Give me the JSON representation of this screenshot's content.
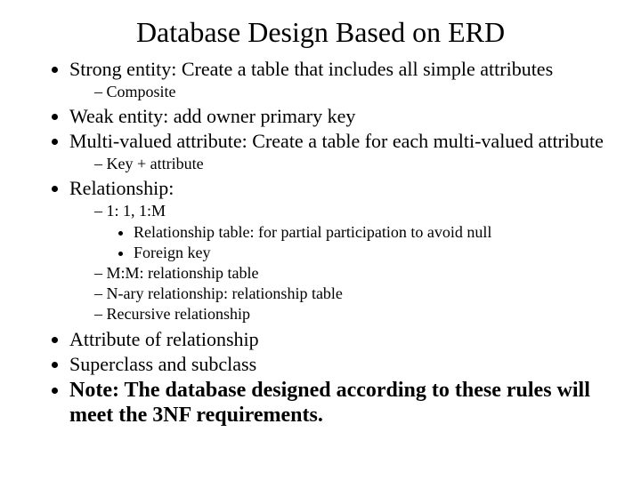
{
  "title": "Database Design Based on ERD",
  "bullets": {
    "strongEntity": "Strong entity: Create a table that includes all simple attributes",
    "composite": "Composite",
    "weakEntity": "Weak entity: add owner primary key",
    "multiValued": "Multi-valued attribute: Create a table for each multi-valued attribute",
    "keyAttribute": "Key + attribute",
    "relationship": "Relationship:",
    "rel11": "1: 1, 1:M",
    "relTable": "Relationship table: for partial participation to avoid null",
    "foreignKey": "Foreign key",
    "mm": "M:M: relationship table",
    "nary": "N-ary relationship: relationship table",
    "recursive": "Recursive relationship",
    "attrOfRel": "Attribute of relationship",
    "superclass": "Superclass and subclass",
    "note": "Note: The database designed according to these rules will meet the 3NF requirements."
  }
}
